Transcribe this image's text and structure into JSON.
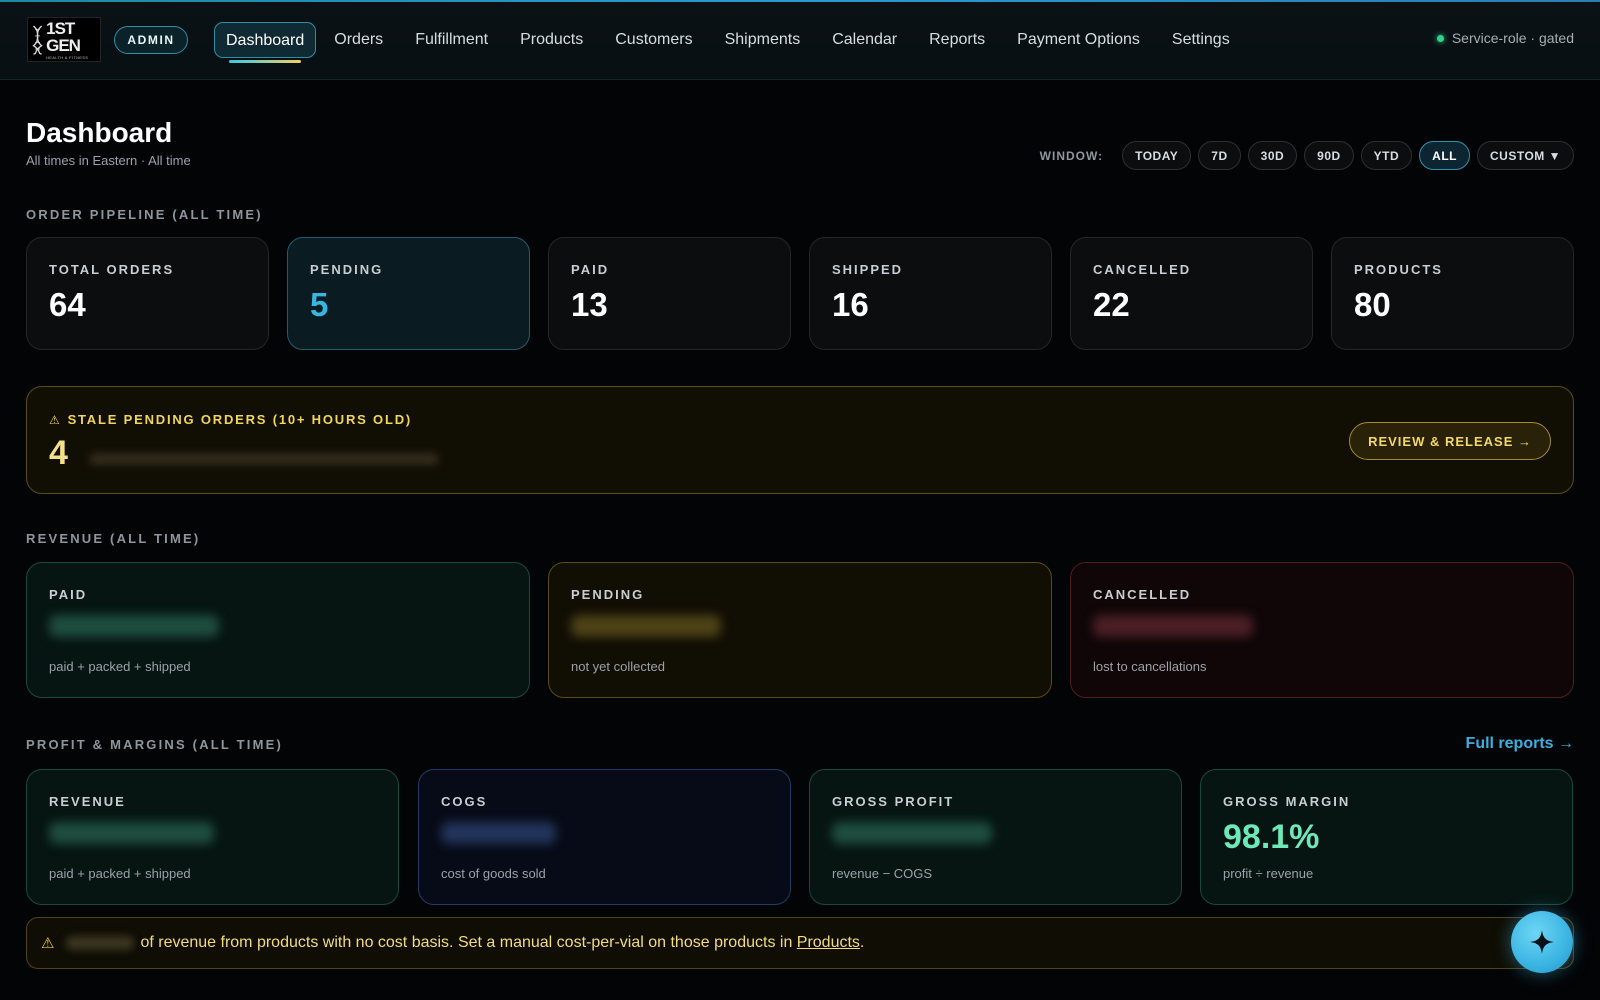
{
  "brand": {
    "logo_main": "1ST GEN",
    "logo_sub": "HEALTH & FITNESS",
    "role_badge": "ADMIN"
  },
  "nav": {
    "items": [
      "Dashboard",
      "Orders",
      "Fulfillment",
      "Products",
      "Customers",
      "Shipments",
      "Calendar",
      "Reports",
      "Payment Options",
      "Settings"
    ],
    "active": "Dashboard"
  },
  "service_status": "Service-role · gated",
  "header": {
    "title": "Dashboard",
    "subtitle": "All times in Eastern · All time"
  },
  "window": {
    "label": "WINDOW:",
    "options": [
      "TODAY",
      "7D",
      "30D",
      "90D",
      "YTD",
      "ALL",
      "CUSTOM ▼"
    ],
    "active": "ALL"
  },
  "pipeline": {
    "title": "ORDER PIPELINE (ALL TIME)",
    "kpis": [
      {
        "label": "TOTAL ORDERS",
        "value": "64"
      },
      {
        "label": "PENDING",
        "value": "5"
      },
      {
        "label": "PAID",
        "value": "13"
      },
      {
        "label": "SHIPPED",
        "value": "16"
      },
      {
        "label": "CANCELLED",
        "value": "22"
      },
      {
        "label": "PRODUCTS",
        "value": "80"
      }
    ]
  },
  "stale": {
    "icon": "warning-icon",
    "label": "STALE PENDING ORDERS (10+ HOURS OLD)",
    "value": "4",
    "button": "REVIEW & RELEASE →"
  },
  "revenue": {
    "title": "REVENUE (ALL TIME)",
    "cards": [
      {
        "label": "PAID",
        "note": "paid + packed + shipped"
      },
      {
        "label": "PENDING",
        "note": "not yet collected"
      },
      {
        "label": "CANCELLED",
        "note": "lost to cancellations"
      }
    ]
  },
  "profit": {
    "title": "PROFIT & MARGINS (ALL TIME)",
    "link": "Full reports →",
    "cards": [
      {
        "label": "REVENUE",
        "note": "paid + packed + shipped"
      },
      {
        "label": "COGS",
        "note": "cost of goods sold"
      },
      {
        "label": "GROSS PROFIT",
        "note": "revenue − COGS"
      },
      {
        "label": "GROSS MARGIN",
        "value": "98.1%",
        "note": "profit ÷ revenue"
      }
    ]
  },
  "alert": {
    "icon": "warning-icon",
    "text": "of revenue from products with no cost basis. Set a manual cost-per-vial on those products in ",
    "link": "Products",
    "end": "."
  },
  "fab_icon": "sparkle-icon",
  "colors": {
    "accent": "#39b6e0",
    "warning": "#f2d65a",
    "positive": "#6ee8b9",
    "danger": "#4e1d22"
  }
}
